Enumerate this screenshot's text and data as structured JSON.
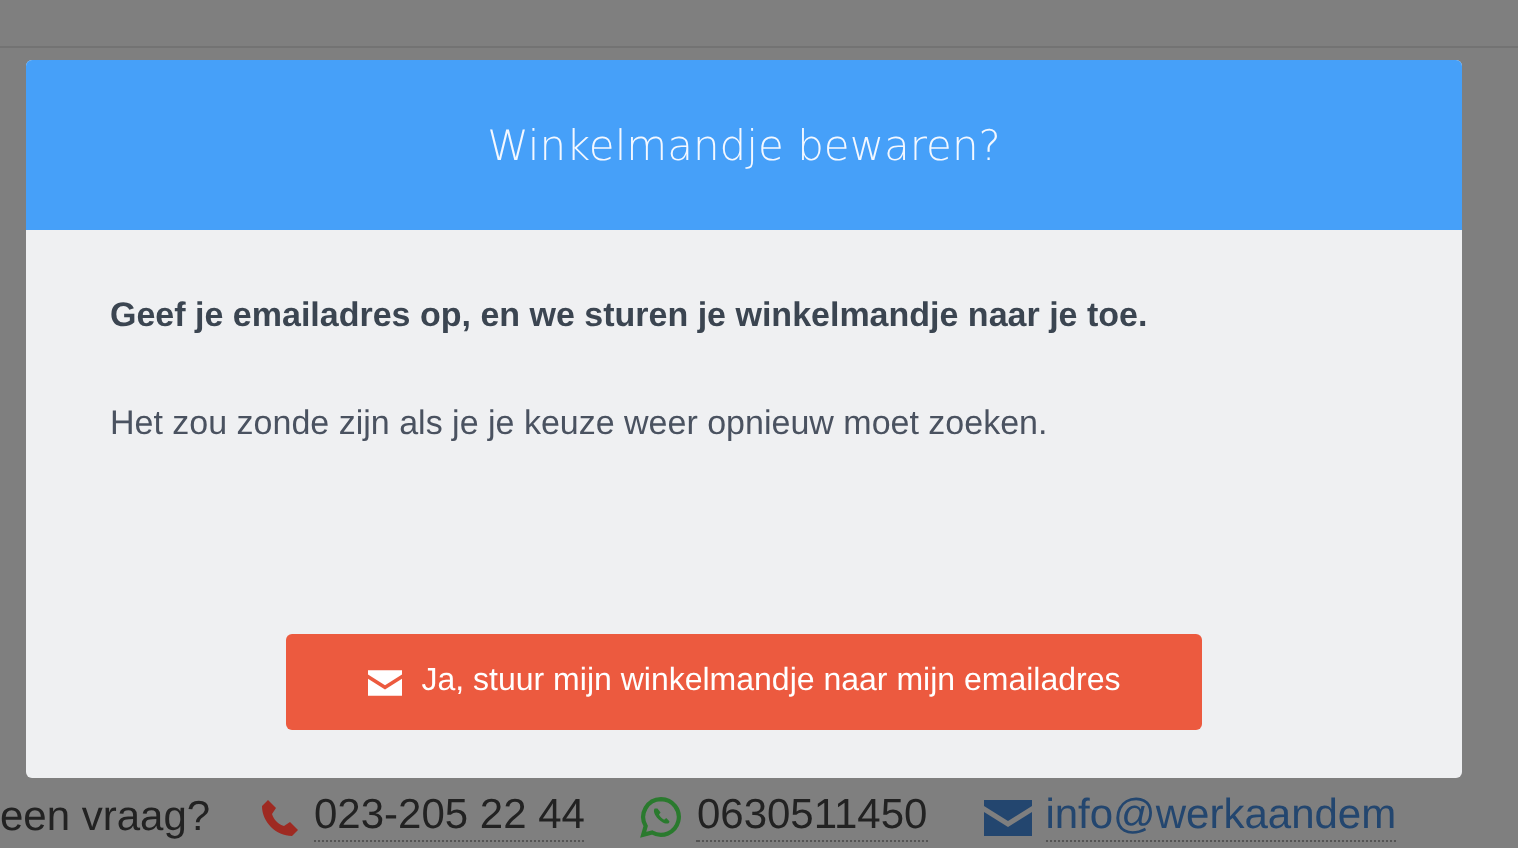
{
  "modal": {
    "title": "Winkelmandje bewaren?",
    "lead": "Geef je emailadres op, en we sturen je winkelmandje naar je toe.",
    "text": "Het zou zonde zijn als je je keuze weer opnieuw moet zoeken.",
    "button": "Ja, stuur mijn winkelmandje naar mijn emailadres"
  },
  "contact_bar": {
    "question": "een vraag?",
    "items": [
      {
        "kind": "phone",
        "text": "023-205 22 44"
      },
      {
        "kind": "whatsapp",
        "text": "0630511450"
      },
      {
        "kind": "email",
        "text": "info@werkaandem"
      }
    ]
  }
}
